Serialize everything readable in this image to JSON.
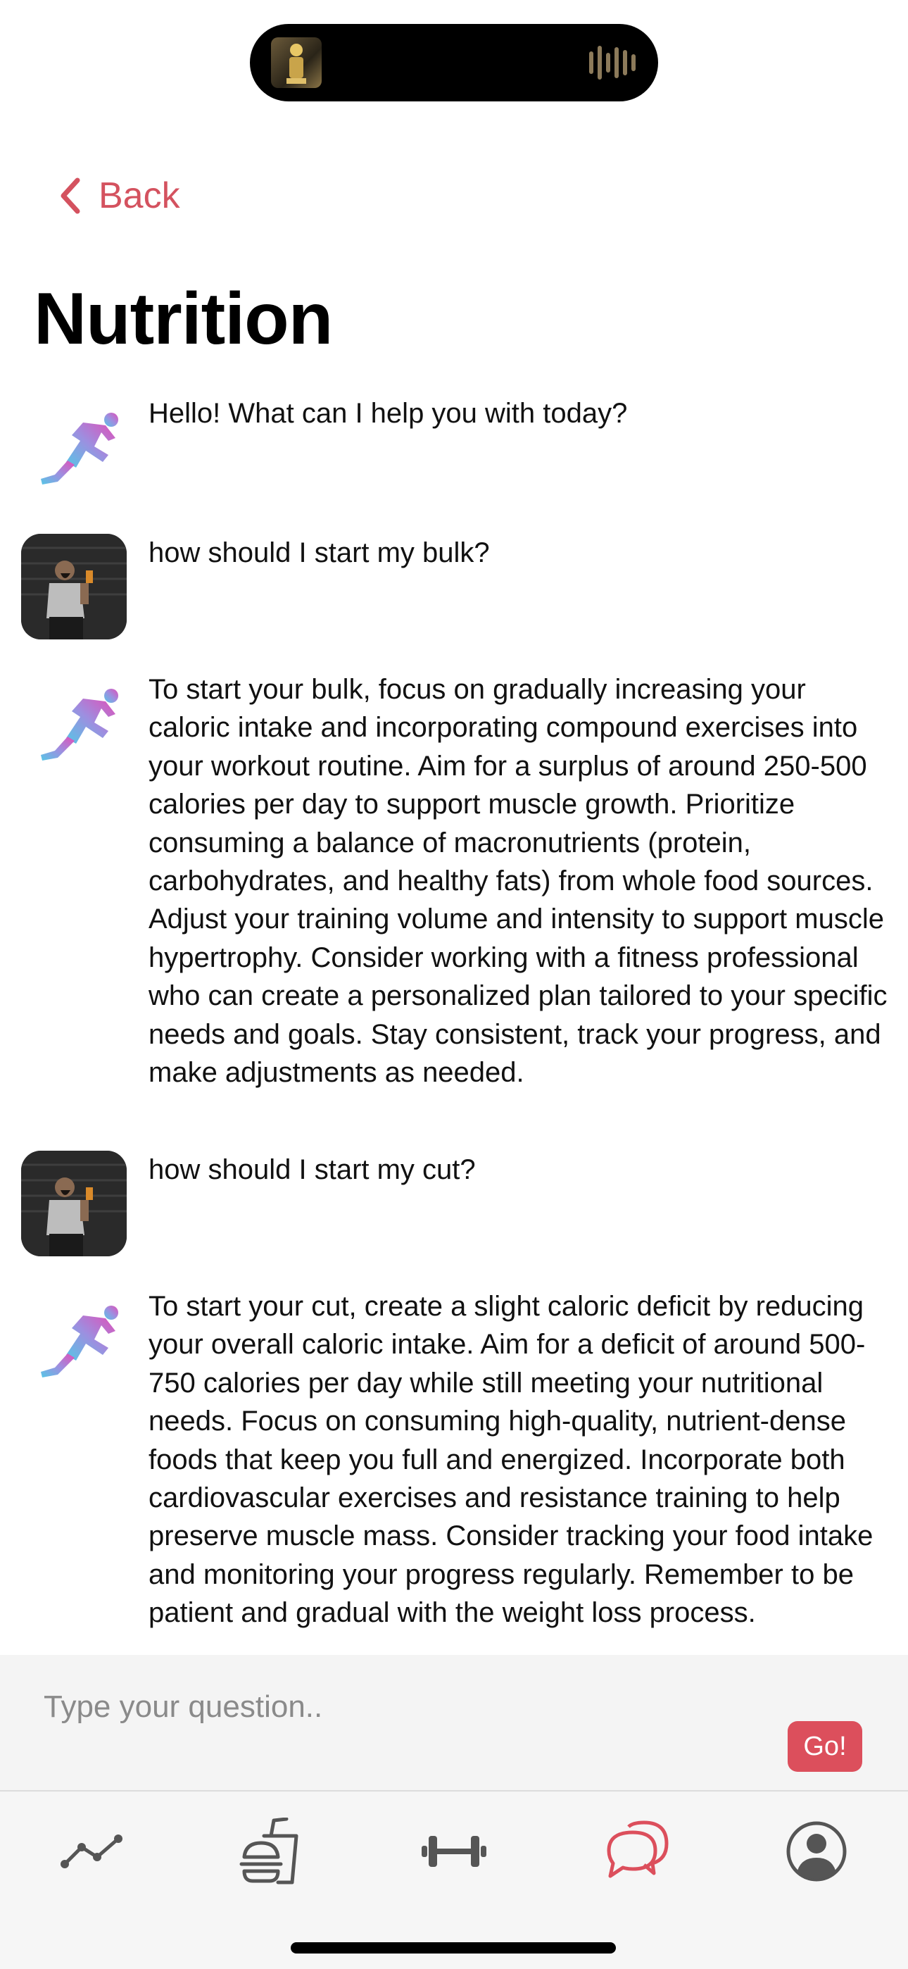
{
  "nav": {
    "back_label": "Back"
  },
  "page": {
    "title": "Nutrition"
  },
  "messages": [
    {
      "sender": "assistant",
      "text": "Hello! What can I help you with today?"
    },
    {
      "sender": "user",
      "text": "how should I start my bulk?"
    },
    {
      "sender": "assistant",
      "text": "To start your bulk, focus on gradually increasing your caloric intake and incorporating compound exercises into your workout routine. Aim for a surplus of around 250-500 calories per day to support muscle growth. Prioritize consuming a balance of macronutrients (protein, carbohydrates, and healthy fats) from whole food sources. Adjust your training volume and intensity to support muscle hypertrophy. Consider working with a fitness professional who can create a personalized plan tailored to your specific needs and goals. Stay consistent, track your progress, and make adjustments as needed."
    },
    {
      "sender": "user",
      "text": "how should I start my cut?"
    },
    {
      "sender": "assistant",
      "text": "To start your cut, create a slight caloric deficit by reducing your overall caloric intake. Aim for a deficit of around 500-750 calories per day while still meeting your nutritional needs. Focus on consuming high-quality, nutrient-dense foods that keep you full and energized. Incorporate both cardiovascular exercises and resistance training to help preserve muscle mass. Consider tracking your food intake and monitoring your progress regularly. Remember to be patient and gradual with the weight loss process."
    }
  ],
  "composer": {
    "placeholder": "Type your question..",
    "value": "",
    "send_label": "Go!"
  },
  "tabs": [
    {
      "icon": "trend-line-icon",
      "active": false
    },
    {
      "icon": "food-icon",
      "active": false
    },
    {
      "icon": "dumbbell-icon",
      "active": false
    },
    {
      "icon": "chat-bubbles-icon",
      "active": true
    },
    {
      "icon": "profile-icon",
      "active": false
    }
  ],
  "colors": {
    "accent": "#dc4f5c",
    "back": "#d4525f",
    "inactive_icon": "#555555"
  }
}
